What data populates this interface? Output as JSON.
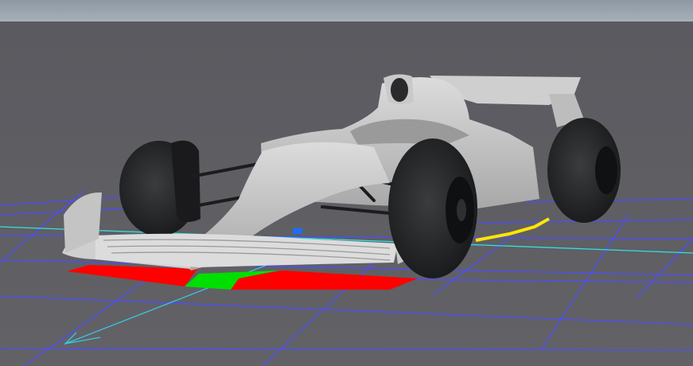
{
  "viewport": {
    "colors": {
      "sky": "#9aa4ae",
      "ground": "#5e5e63",
      "grid_line": "#4d4dff",
      "axis_x": "#33e0e0",
      "axis_z": "#3ac6e6",
      "body": "#d4d4d4",
      "body_shadow": "#8f8f8f",
      "tyre": "#202224",
      "marker_red": "#ff0000",
      "marker_green": "#00e000",
      "marker_yellow": "#ffe600",
      "marker_blue": "#1e6cff"
    },
    "objects": [
      "floor-grid",
      "x-axis-line",
      "z-axis-line",
      "formula-car-model",
      "red-zone-marker",
      "green-zone-marker",
      "yellow-edge-marker"
    ]
  }
}
